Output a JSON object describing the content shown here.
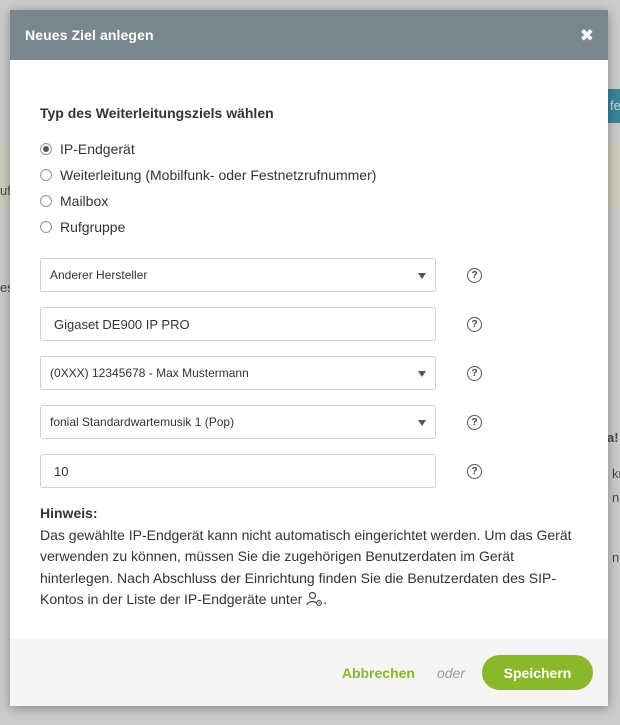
{
  "background": {
    "fragments": [
      "ufg",
      "es",
      "a!",
      "kn",
      "ne",
      "n",
      "fe"
    ]
  },
  "dialog": {
    "title": "Neues Ziel anlegen",
    "close_icon": "close-icon",
    "section_heading": "Typ des Weiterleitungsziels wählen",
    "target_types": [
      {
        "label": "IP-Endgerät",
        "checked": true
      },
      {
        "label": "Weiterleitung (Mobilfunk- oder Festnetzrufnummer)",
        "checked": false
      },
      {
        "label": "Mailbox",
        "checked": false
      },
      {
        "label": "Rufgruppe",
        "checked": false
      }
    ],
    "fields": {
      "manufacturer": "Anderer Hersteller",
      "device_name": "Gigaset DE900 IP PRO",
      "phone_number": "(0XXX) 12345678 - Max Mustermann",
      "hold_music": "fonial Standardwartemusik 1 (Pop)",
      "number_value": "10"
    },
    "help_symbol": "?",
    "hint": {
      "title": "Hinweis:",
      "text": "Das gewählte IP-Endgerät kann nicht automatisch eingerichtet werden. Um das Gerät verwenden zu können, müssen Sie die zugehörigen Benutzerdaten im Gerät hinterlegen. Nach Abschluss der Einrichtung finden Sie die Benutzerdaten des SIP-Kontos in der Liste der IP-Endgeräte unter ",
      "end": "."
    },
    "footer": {
      "cancel_label": "Abbrechen",
      "or_label": "oder",
      "save_label": "Speichern"
    }
  },
  "colors": {
    "header_bg": "#7a868d",
    "accent_green": "#8ab82a",
    "background_teal_button": "#1e8aa6"
  }
}
